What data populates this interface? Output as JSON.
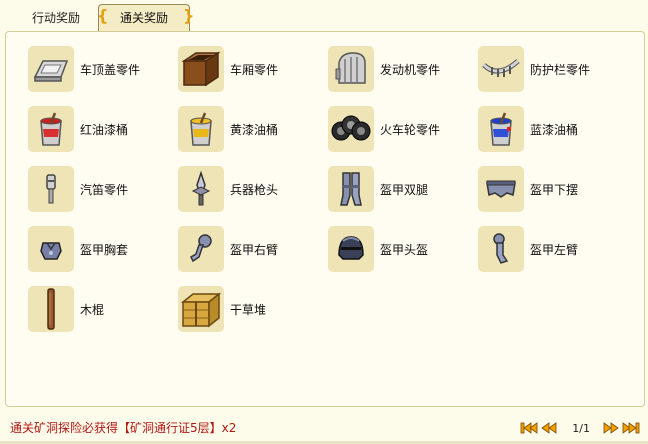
{
  "tabs": [
    {
      "label": "行动奖励",
      "active": false
    },
    {
      "label": "通关奖励",
      "active": true
    }
  ],
  "items": [
    {
      "label": "车顶盖零件",
      "icon": "roof-part-icon"
    },
    {
      "label": "车厢零件",
      "icon": "carriage-box-icon"
    },
    {
      "label": "发动机零件",
      "icon": "engine-part-icon"
    },
    {
      "label": "防护栏零件",
      "icon": "guardrail-part-icon"
    },
    {
      "label": "红油漆桶",
      "icon": "red-paint-bucket-icon"
    },
    {
      "label": "黄漆油桶",
      "icon": "yellow-paint-bucket-icon"
    },
    {
      "label": "火车轮零件",
      "icon": "train-wheel-icon"
    },
    {
      "label": "蓝漆油桶",
      "icon": "blue-paint-bucket-icon"
    },
    {
      "label": "汽笛零件",
      "icon": "whistle-part-icon"
    },
    {
      "label": "兵器枪头",
      "icon": "spearhead-icon"
    },
    {
      "label": "盔甲双腿",
      "icon": "armor-legs-icon"
    },
    {
      "label": "盔甲下摆",
      "icon": "armor-skirt-icon"
    },
    {
      "label": "盔甲胸套",
      "icon": "armor-chest-icon"
    },
    {
      "label": "盔甲右臂",
      "icon": "armor-right-arm-icon"
    },
    {
      "label": "盔甲头盔",
      "icon": "armor-helmet-icon"
    },
    {
      "label": "盔甲左臂",
      "icon": "armor-left-arm-icon"
    },
    {
      "label": "木棍",
      "icon": "wooden-stick-icon"
    },
    {
      "label": "干草堆",
      "icon": "haystack-icon"
    }
  ],
  "footer": {
    "reward_text": "通关矿洞探险必获得【矿洞通行证5层】x2"
  },
  "pager": {
    "page_info": "1/1"
  },
  "colors": {
    "background": "#fdfbe9",
    "slot": "#efe4b6",
    "footer_text": "#b01818",
    "pager_arrow": "#f0a000"
  }
}
